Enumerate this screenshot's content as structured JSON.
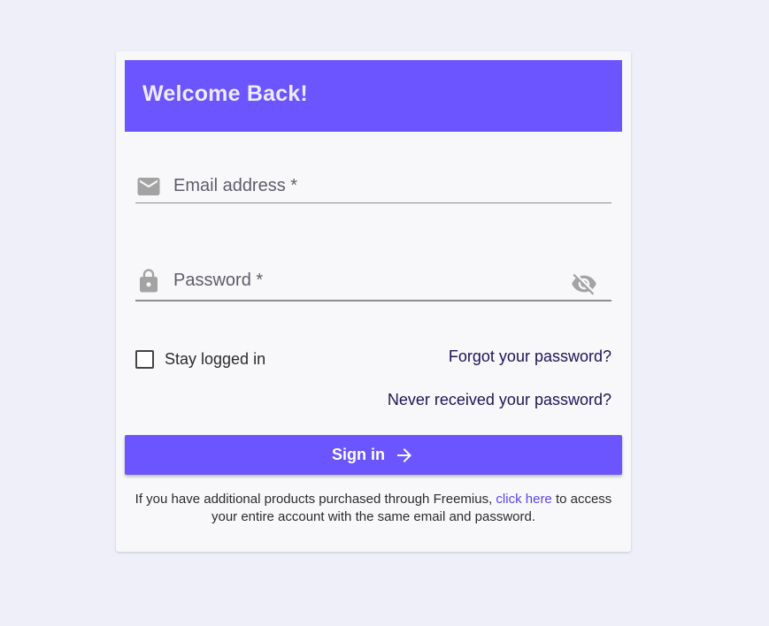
{
  "header": {
    "title": "Welcome Back!"
  },
  "form": {
    "email": {
      "placeholder": "Email address *",
      "value": "",
      "icon": "envelope-icon"
    },
    "password": {
      "placeholder": "Password *",
      "value": "",
      "icon": "lock-icon",
      "toggle_icon": "eye-off-icon"
    },
    "stay_logged_in": {
      "label": "Stay logged in",
      "checked": false
    },
    "forgot_link": "Forgot your password?",
    "never_received_link": "Never received your password?",
    "signin_label": "Sign in",
    "signin_icon": "arrow-right-icon"
  },
  "footer": {
    "text_before": "If you have additional products purchased through Freemius, ",
    "link_label": "click here",
    "text_after": " to access your entire account with the same email and password."
  },
  "colors": {
    "page_background": "#efeff9",
    "accent": "#6c54ff",
    "link": "#1d1458",
    "footer_link": "#5a45e6"
  }
}
